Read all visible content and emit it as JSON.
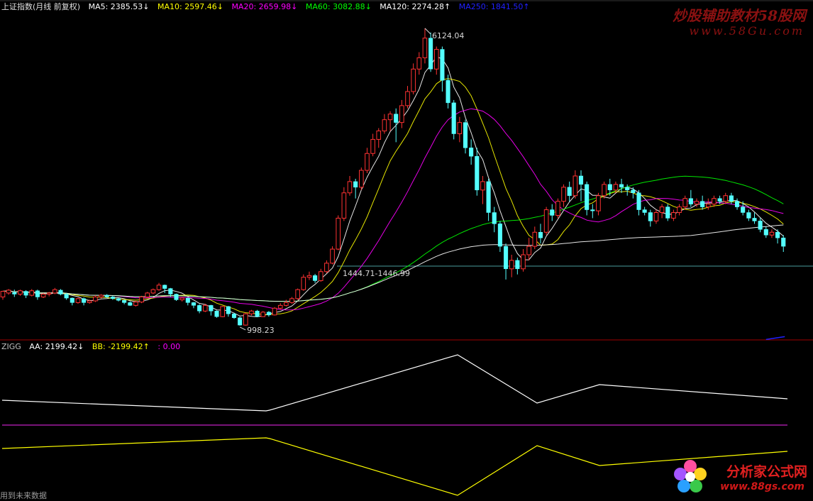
{
  "header": {
    "title": "上证指数(月线 前复权)",
    "ma5": "MA5: 2385.53↓",
    "ma10": "MA10: 2597.46↓",
    "ma20": "MA20: 2659.98↓",
    "ma60": "MA60: 3082.88↓",
    "ma120": "MA120: 2274.28↑",
    "ma250": "MA250: 1841.50↑"
  },
  "sub_header": {
    "name": "ZIGG",
    "aa": "AA: 2199.42↓",
    "bb": "BB: -2199.42↑",
    "cc": ": 0.00"
  },
  "footer": {
    "text": "用到未来数据"
  },
  "watermarks": {
    "top_title": "炒股辅助教材58股网",
    "top_url": "www.58Gu.com",
    "bottom_title": "分析家公式网",
    "bottom_url": "www.88gs.com"
  },
  "colors": {
    "up": "#ff3232",
    "down": "#54ffff",
    "ma5": "#ffffff",
    "ma10": "#ffff00",
    "ma20": "#ff00ff",
    "ma60": "#00ff00",
    "ma120": "#ffffff",
    "ma250": "#2020ff",
    "divider": "#a00000",
    "ref_line": "#4a9c9c",
    "zero_line": "#c020c0"
  },
  "chart_data": {
    "type": "candlestick",
    "ylim": [
      700,
      6400
    ],
    "extreme_labels": [
      "6124.04",
      "998.23",
      "1444.71-1446.99"
    ],
    "candles": [
      [
        1350,
        1450,
        1300,
        1460
      ],
      [
        1420,
        1470,
        1390,
        1490
      ],
      [
        1430,
        1400,
        1350,
        1480
      ],
      [
        1400,
        1460,
        1370,
        1480
      ],
      [
        1450,
        1380,
        1330,
        1470
      ],
      [
        1380,
        1460,
        1360,
        1490
      ],
      [
        1460,
        1350,
        1300,
        1480
      ],
      [
        1350,
        1400,
        1330,
        1420
      ],
      [
        1400,
        1420,
        1360,
        1440
      ],
      [
        1420,
        1480,
        1400,
        1510
      ],
      [
        1470,
        1400,
        1380,
        1490
      ],
      [
        1400,
        1330,
        1300,
        1420
      ],
      [
        1330,
        1250,
        1200,
        1340
      ],
      [
        1250,
        1320,
        1230,
        1340
      ],
      [
        1320,
        1250,
        1200,
        1340
      ],
      [
        1250,
        1280,
        1230,
        1300
      ],
      [
        1280,
        1350,
        1260,
        1380
      ],
      [
        1350,
        1380,
        1320,
        1400
      ],
      [
        1380,
        1350,
        1330,
        1400
      ],
      [
        1350,
        1320,
        1300,
        1370
      ],
      [
        1320,
        1290,
        1270,
        1330
      ],
      [
        1290,
        1250,
        1220,
        1300
      ],
      [
        1250,
        1200,
        1190,
        1270
      ],
      [
        1200,
        1260,
        1180,
        1280
      ],
      [
        1260,
        1350,
        1240,
        1370
      ],
      [
        1350,
        1420,
        1330,
        1440
      ],
      [
        1420,
        1480,
        1400,
        1500
      ],
      [
        1480,
        1560,
        1460,
        1600
      ],
      [
        1560,
        1500,
        1420,
        1570
      ],
      [
        1500,
        1400,
        1350,
        1510
      ],
      [
        1400,
        1300,
        1280,
        1410
      ],
      [
        1300,
        1330,
        1270,
        1350
      ],
      [
        1330,
        1250,
        1200,
        1340
      ],
      [
        1250,
        1200,
        1150,
        1260
      ],
      [
        1200,
        1100,
        1060,
        1220
      ],
      [
        1100,
        1200,
        1080,
        1230
      ],
      [
        1200,
        1100,
        1020,
        1210
      ],
      [
        1100,
        1000,
        980,
        1110
      ],
      [
        1000,
        1180,
        990,
        1190
      ],
      [
        1180,
        1050,
        1000,
        1190
      ],
      [
        1050,
        980,
        960,
        1070
      ],
      [
        980,
        850,
        840,
        1000
      ],
      [
        850,
        1050,
        840,
        1070
      ],
      [
        1050,
        1100,
        1020,
        1120
      ],
      [
        1100,
        1000,
        990,
        1120
      ],
      [
        1000,
        1080,
        998,
        1100
      ],
      [
        1080,
        1030,
        1000,
        1100
      ],
      [
        1030,
        1150,
        1020,
        1170
      ],
      [
        1150,
        1200,
        1120,
        1240
      ],
      [
        1200,
        1250,
        1180,
        1300
      ],
      [
        1250,
        1320,
        1230,
        1350
      ],
      [
        1320,
        1480,
        1300,
        1500
      ],
      [
        1480,
        1700,
        1460,
        1750
      ],
      [
        1700,
        1730,
        1650,
        1800
      ],
      [
        1730,
        1640,
        1600,
        1760
      ],
      [
        1640,
        1800,
        1620,
        1850
      ],
      [
        1800,
        1950,
        1770,
        2000
      ],
      [
        1950,
        2200,
        1930,
        2250
      ],
      [
        2200,
        2750,
        2180,
        2800
      ],
      [
        2750,
        3200,
        2700,
        3300
      ],
      [
        3200,
        3400,
        3150,
        3500
      ],
      [
        3400,
        3300,
        3100,
        3450
      ],
      [
        3300,
        3600,
        3250,
        3650
      ],
      [
        3600,
        3900,
        3550,
        4000
      ],
      [
        3900,
        4150,
        3850,
        4250
      ],
      [
        4150,
        4300,
        4000,
        4350
      ],
      [
        4300,
        4500,
        4250,
        4600
      ],
      [
        4500,
        4600,
        4300,
        4650
      ],
      [
        4600,
        4450,
        4100,
        4700
      ],
      [
        4450,
        4750,
        4350,
        4850
      ],
      [
        4750,
        5000,
        4700,
        5100
      ],
      [
        5000,
        5400,
        4950,
        5500
      ],
      [
        5400,
        5600,
        5300,
        5700
      ],
      [
        5600,
        5950,
        5500,
        6124
      ],
      [
        5950,
        5400,
        5350,
        6050
      ],
      [
        5400,
        5750,
        5300,
        5800
      ],
      [
        5750,
        5200,
        5000,
        5800
      ],
      [
        5200,
        4800,
        4700,
        5300
      ],
      [
        4800,
        4250,
        4150,
        4850
      ],
      [
        4250,
        4450,
        4100,
        4550
      ],
      [
        4450,
        4000,
        3900,
        4500
      ],
      [
        4000,
        3850,
        3700,
        4150
      ],
      [
        3850,
        3250,
        3150,
        4000
      ],
      [
        3250,
        3400,
        3000,
        3500
      ],
      [
        3400,
        2850,
        2700,
        3450
      ],
      [
        2850,
        2650,
        2500,
        2950
      ],
      [
        2650,
        2250,
        2150,
        2700
      ],
      [
        2250,
        1850,
        1660,
        2300
      ],
      [
        1850,
        2000,
        1700,
        2100
      ],
      [
        2000,
        1850,
        1750,
        2050
      ],
      [
        1850,
        2100,
        1800,
        2200
      ],
      [
        2100,
        2250,
        2000,
        2400
      ],
      [
        2250,
        2500,
        2200,
        2600
      ],
      [
        2500,
        2400,
        2300,
        2650
      ],
      [
        2500,
        2900,
        2450,
        2950
      ],
      [
        2900,
        2800,
        2700,
        3000
      ],
      [
        2800,
        3050,
        2750,
        3100
      ],
      [
        3050,
        3300,
        2950,
        3350
      ],
      [
        3300,
        3150,
        3050,
        3400
      ],
      [
        3150,
        3500,
        3100,
        3600
      ],
      [
        3500,
        3350,
        3050,
        3600
      ],
      [
        3350,
        2900,
        2800,
        3400
      ],
      [
        2900,
        2880,
        2750,
        3000
      ],
      [
        2880,
        3150,
        2800,
        3200
      ],
      [
        3150,
        3350,
        3100,
        3400
      ],
      [
        3350,
        3250,
        3150,
        3450
      ],
      [
        3250,
        3350,
        3200,
        3400
      ],
      [
        3350,
        3300,
        3200,
        3450
      ],
      [
        3300,
        3250,
        3150,
        3350
      ],
      [
        3250,
        3200,
        3100,
        3300
      ],
      [
        3200,
        2900,
        2800,
        3250
      ],
      [
        2900,
        2850,
        2800,
        2950
      ],
      [
        2850,
        2700,
        2600,
        2900
      ],
      [
        2700,
        2850,
        2650,
        2900
      ],
      [
        2850,
        2950,
        2750,
        3000
      ],
      [
        2950,
        2750,
        2700,
        3000
      ],
      [
        2750,
        2850,
        2700,
        2900
      ],
      [
        2850,
        2950,
        2800,
        3000
      ],
      [
        2950,
        3100,
        2900,
        3150
      ],
      [
        3100,
        3000,
        2950,
        3250
      ],
      [
        3000,
        3050,
        2950,
        3100
      ],
      [
        3050,
        2950,
        2900,
        3150
      ],
      [
        2950,
        3000,
        2900,
        3100
      ],
      [
        3000,
        3100,
        2950,
        3150
      ],
      [
        3100,
        3050,
        3000,
        3150
      ],
      [
        3050,
        3150,
        3000,
        3200
      ],
      [
        3150,
        3050,
        3000,
        3200
      ],
      [
        3050,
        2950,
        2900,
        3100
      ],
      [
        2950,
        2850,
        2800,
        3050
      ],
      [
        2850,
        2750,
        2700,
        2900
      ],
      [
        2750,
        2700,
        2650,
        2850
      ],
      [
        2700,
        2550,
        2500,
        2750
      ],
      [
        2550,
        2450,
        2400,
        2600
      ],
      [
        2450,
        2500,
        2400,
        2550
      ],
      [
        2500,
        2400,
        2300,
        2550
      ],
      [
        2400,
        2250,
        2150,
        2450
      ]
    ]
  }
}
